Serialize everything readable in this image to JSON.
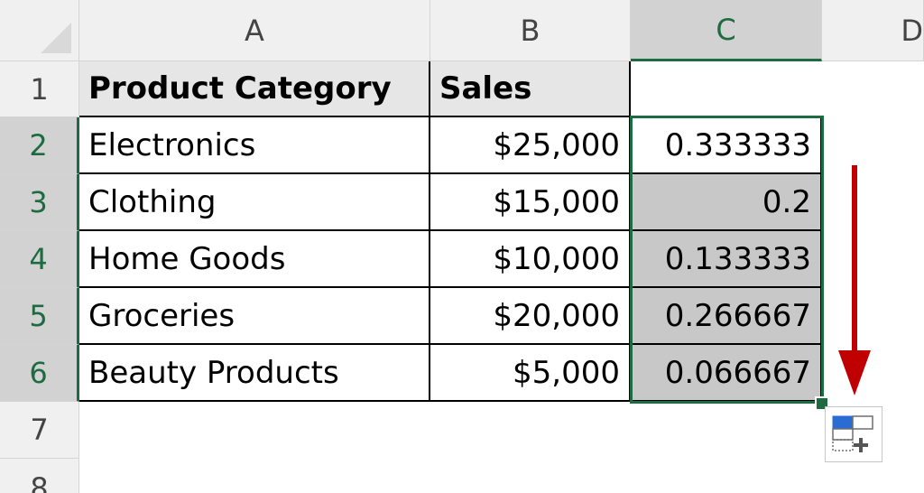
{
  "columns": [
    "A",
    "B",
    "C",
    "D"
  ],
  "rows": [
    "1",
    "2",
    "3",
    "4",
    "5",
    "6",
    "7",
    "8"
  ],
  "table": {
    "header": {
      "category": "Product Category",
      "sales": "Sales"
    },
    "rows": [
      {
        "category": "Electronics",
        "sales": "$25,000",
        "ratio": "0.333333"
      },
      {
        "category": "Clothing",
        "sales": "$15,000",
        "ratio": "0.2"
      },
      {
        "category": "Home Goods",
        "sales": "$10,000",
        "ratio": "0.133333"
      },
      {
        "category": "Groceries",
        "sales": "$20,000",
        "ratio": "0.266667"
      },
      {
        "category": "Beauty Products",
        "sales": "$5,000",
        "ratio": "0.066667"
      }
    ]
  },
  "selection": {
    "range": "C2:C6",
    "active_column": "C"
  },
  "annotation": {
    "arrow_color": "#c00000",
    "direction": "down"
  },
  "icons": {
    "autofill_options": "autofill-options-icon",
    "select_all": "select-all-triangle-icon"
  },
  "colors": {
    "selection_accent": "#1e6b41",
    "header_fill": "#e7e6e6",
    "filled_cell": "#c8c8c8"
  }
}
